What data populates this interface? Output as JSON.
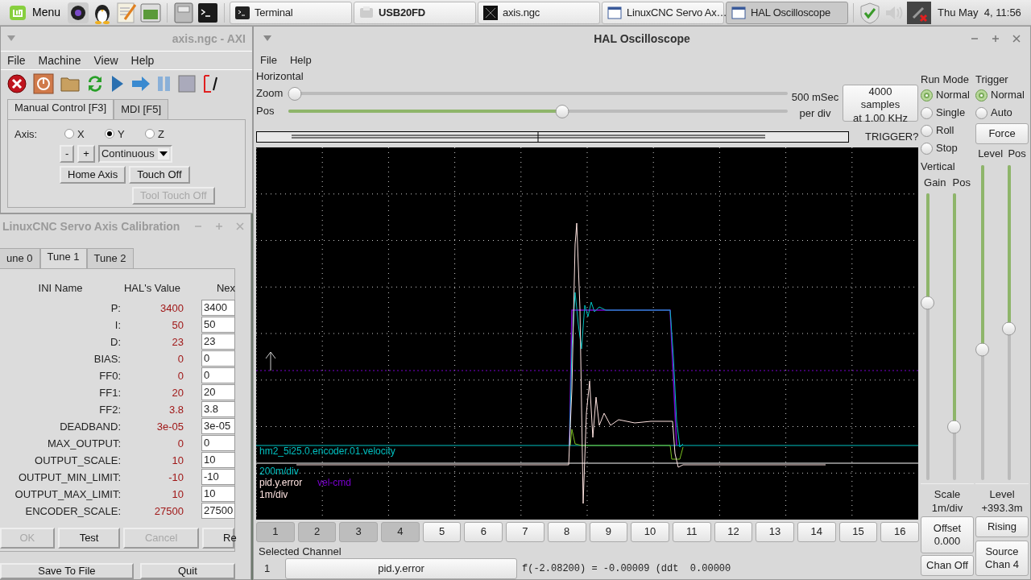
{
  "taskbar": {
    "menu_label": "Menu",
    "tasks": [
      {
        "label": "Terminal",
        "kind": "terminal",
        "selected": false,
        "urgent": false
      },
      {
        "label": "USB20FD",
        "kind": "drive",
        "selected": false,
        "urgent": true
      },
      {
        "label": "axis.ngc",
        "kind": "image",
        "selected": false,
        "urgent": false
      },
      {
        "label": "LinuxCNC Servo Ax…",
        "kind": "window",
        "selected": false,
        "urgent": false
      },
      {
        "label": "HAL Oscilloscope",
        "kind": "window",
        "selected": true,
        "urgent": false
      }
    ],
    "clock": "Thu May  4, 11:56"
  },
  "axis_window": {
    "title": "axis.ngc - AXI",
    "menu": [
      "File",
      "Machine",
      "View",
      "Help"
    ],
    "tabs": [
      {
        "label": "Manual Control [F3]",
        "selected": true
      },
      {
        "label": "MDI [F5]",
        "selected": false
      }
    ],
    "axis_label": "Axis:",
    "axes": [
      {
        "label": "X",
        "selected": false
      },
      {
        "label": "Y",
        "selected": true
      },
      {
        "label": "Z",
        "selected": false
      }
    ],
    "jog_buttons": [
      "-",
      "+"
    ],
    "jog_mode": "Continuous",
    "buttons": [
      {
        "label": "Home Axis",
        "disabled": false
      },
      {
        "label": "Touch Off",
        "disabled": false
      },
      {
        "label": "Tool Touch Off",
        "disabled": true
      }
    ]
  },
  "calibration_window": {
    "title": "LinuxCNC Servo Axis Calibration",
    "tabs": [
      {
        "label": "une 0",
        "selected": false
      },
      {
        "label": "Tune 1",
        "selected": true
      },
      {
        "label": "Tune 2",
        "selected": false
      }
    ],
    "columns": [
      "INI Name",
      "HAL's Value",
      "Nex"
    ],
    "rows": [
      {
        "name": "P:",
        "hal_value": "3400",
        "next": "3400"
      },
      {
        "name": "I:",
        "hal_value": "50",
        "next": "50"
      },
      {
        "name": "D:",
        "hal_value": "23",
        "next": "23"
      },
      {
        "name": "BIAS:",
        "hal_value": "0",
        "next": "0"
      },
      {
        "name": "FF0:",
        "hal_value": "0",
        "next": "0"
      },
      {
        "name": "FF1:",
        "hal_value": "20",
        "next": "20"
      },
      {
        "name": "FF2:",
        "hal_value": "3.8",
        "next": "3.8"
      },
      {
        "name": "DEADBAND:",
        "hal_value": "3e-05",
        "next": "3e-05"
      },
      {
        "name": "MAX_OUTPUT:",
        "hal_value": "0",
        "next": "0"
      },
      {
        "name": "OUTPUT_SCALE:",
        "hal_value": "10",
        "next": "10"
      },
      {
        "name": "OUTPUT_MIN_LIMIT:",
        "hal_value": "-10",
        "next": "-10"
      },
      {
        "name": "OUTPUT_MAX_LIMIT:",
        "hal_value": "10",
        "next": "10"
      },
      {
        "name": "ENCODER_SCALE:",
        "hal_value": "27500",
        "next": "27500"
      }
    ],
    "buttons": [
      {
        "label": "OK",
        "disabled": true
      },
      {
        "label": "Test",
        "disabled": false
      },
      {
        "label": "Cancel",
        "disabled": true
      },
      {
        "label": "Re",
        "disabled": false
      }
    ],
    "footer_buttons": [
      "Save To File",
      "Quit"
    ]
  },
  "scope_window": {
    "title": "HAL Oscilloscope",
    "menu": [
      "File",
      "Help"
    ],
    "horizontal": {
      "label": "Horizontal",
      "zoom_label": "Zoom",
      "zoom": {
        "level": 0
      },
      "pos_label": "Pos",
      "pos": {
        "level": 0.55
      },
      "rate": "500 mSec",
      "rate_unit": "per div",
      "samples_button": [
        "4000 samples",
        "at 1.00 KHz"
      ]
    },
    "trigger_status": "TRIGGER?",
    "trace_labels": [
      {
        "name": "hm2_5i25.0.encoder.01.velocity",
        "scale": "200m/div",
        "color": "#00c0c0"
      },
      {
        "name": "pid.y.error",
        "scale": "1m/div",
        "color": "#ffe4e1"
      },
      {
        "name": "vel-cmd",
        "color": "#7a00d0"
      }
    ],
    "channels": [
      {
        "label": "1",
        "on": true
      },
      {
        "label": "2",
        "on": true
      },
      {
        "label": "3",
        "on": true
      },
      {
        "label": "4",
        "on": true
      },
      {
        "label": "5",
        "on": false
      },
      {
        "label": "6",
        "on": false
      },
      {
        "label": "7",
        "on": false
      },
      {
        "label": "8",
        "on": false
      },
      {
        "label": "9",
        "on": false
      },
      {
        "label": "10",
        "on": false
      },
      {
        "label": "11",
        "on": false
      },
      {
        "label": "12",
        "on": false
      },
      {
        "label": "13",
        "on": false
      },
      {
        "label": "14",
        "on": false
      },
      {
        "label": "15",
        "on": false
      },
      {
        "label": "16",
        "on": false
      }
    ],
    "selected_channel_label": "Selected Channel",
    "selected_channel": {
      "number": "1",
      "name": "pid.y.error"
    },
    "readout": "f(-2.08200) = -0.00009 (ddt  0.00000",
    "run_mode": {
      "label": "Run Mode",
      "options": [
        {
          "label": "Normal",
          "selected": true
        },
        {
          "label": "Single",
          "selected": false
        },
        {
          "label": "Roll",
          "selected": false
        },
        {
          "label": "Stop",
          "selected": false
        }
      ]
    },
    "vertical": {
      "label": "Vertical",
      "gain_label": "Gain",
      "pos_label": "Pos",
      "scale_caption": "Scale",
      "scale_value": "1m/div",
      "offset_button": [
        "Offset",
        "0.000"
      ],
      "chan_off_button": "Chan Off"
    },
    "trigger": {
      "label": "Trigger",
      "options": [
        {
          "label": "Normal",
          "selected": true
        },
        {
          "label": "Auto",
          "selected": false
        }
      ],
      "force_button": "Force",
      "level_label": "Level",
      "pos_label": "Pos",
      "level_caption": "Level",
      "level_value": "+393.3m",
      "edge_button": "Rising",
      "source_button": [
        "Source",
        "Chan 4"
      ]
    }
  }
}
